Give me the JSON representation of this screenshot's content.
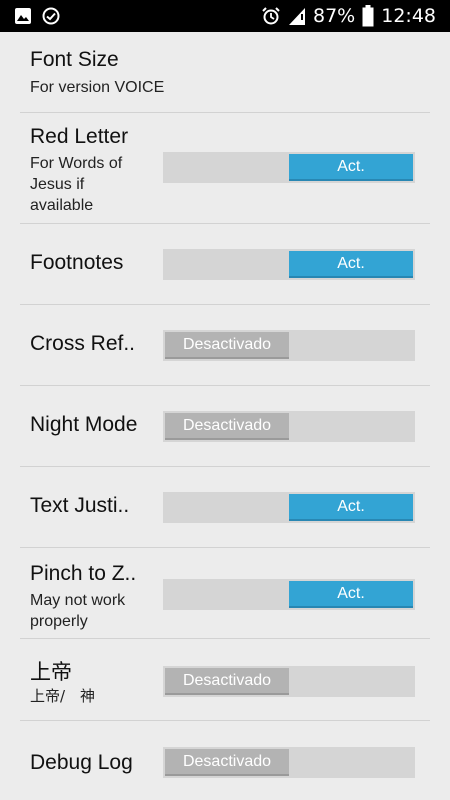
{
  "status_bar": {
    "left_icons": [
      "gallery-icon",
      "check-circle-icon"
    ],
    "right_icons": [
      "alarm-icon",
      "signal-icon",
      "battery-icon"
    ],
    "battery": "87%",
    "time": "12:48"
  },
  "settings": {
    "font_size": {
      "title": "Font Size",
      "subtitle": "For version VOICE"
    },
    "red_letter": {
      "title": "Red Letter",
      "subtitle_line1": "For Words of",
      "subtitle_line2": "Jesus if",
      "subtitle_line3": "available",
      "toggle": "Act.",
      "state": "on"
    },
    "footnotes": {
      "title": "Footnotes",
      "toggle": "Act.",
      "state": "on"
    },
    "cross_ref": {
      "title": "Cross Ref..",
      "toggle": "Desactivado",
      "state": "off"
    },
    "night_mode": {
      "title": "Night Mode",
      "toggle": "Desactivado",
      "state": "off"
    },
    "text_justify": {
      "title": "Text Justi..",
      "toggle": "Act.",
      "state": "on"
    },
    "pinch_zoom": {
      "title": "Pinch to Z..",
      "subtitle_line1": "May not work",
      "subtitle_line2": "properly",
      "toggle": "Act.",
      "state": "on"
    },
    "god": {
      "title": "上帝",
      "subtitle": "上帝/　神",
      "toggle": "Desactivado",
      "state": "off"
    },
    "debug_log": {
      "title": "Debug Log",
      "toggle": "Desactivado",
      "state": "off"
    }
  },
  "colors": {
    "on": "#33a4d4",
    "off_thumb": "#b3b3b3",
    "track": "#d5d5d5",
    "background": "#ececec"
  }
}
